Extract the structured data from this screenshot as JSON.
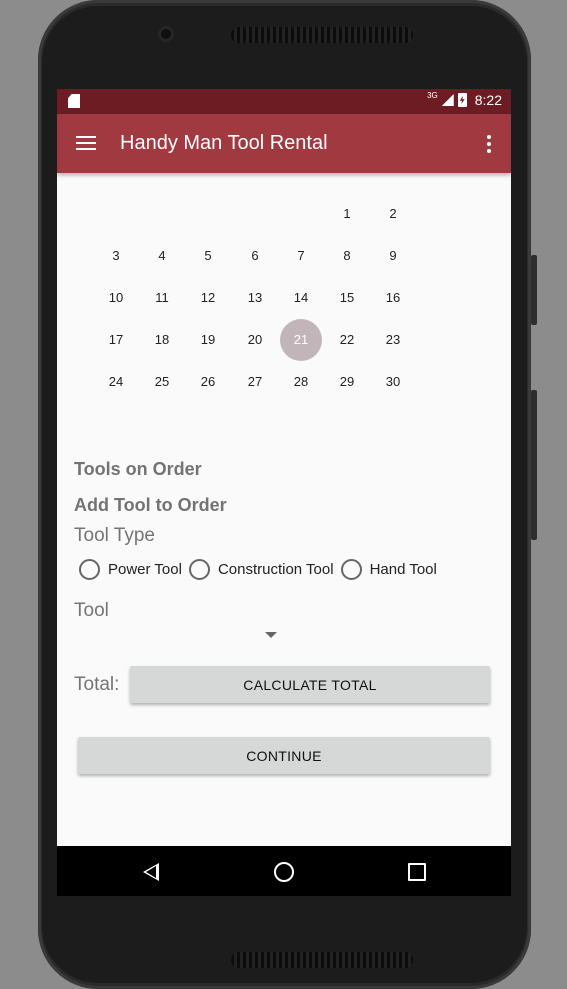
{
  "status_bar": {
    "network": "3G",
    "time": "8:22"
  },
  "app_bar": {
    "title": "Handy Man Tool Rental"
  },
  "calendar": {
    "selected_day": "21",
    "weeks": [
      [
        "",
        "",
        "",
        "",
        "",
        "1",
        "2"
      ],
      [
        "3",
        "4",
        "5",
        "6",
        "7",
        "8",
        "9"
      ],
      [
        "10",
        "11",
        "12",
        "13",
        "14",
        "15",
        "16"
      ],
      [
        "17",
        "18",
        "19",
        "20",
        "21",
        "22",
        "23"
      ],
      [
        "24",
        "25",
        "26",
        "27",
        "28",
        "29",
        "30"
      ]
    ]
  },
  "order": {
    "tools_on_order_title": "Tools on Order",
    "add_tool_title": "Add Tool to Order",
    "tool_type_label": "Tool Type",
    "tool_types": [
      "Power Tool",
      "Construction Tool",
      "Hand Tool"
    ],
    "tool_label": "Tool",
    "total_label": "Total:",
    "calculate_button": "CALCULATE TOTAL",
    "continue_button": "CONTINUE"
  },
  "colors": {
    "status_bar": "#6e1c23",
    "app_bar": "#a03940",
    "selected_day": "#c1b5ba"
  }
}
